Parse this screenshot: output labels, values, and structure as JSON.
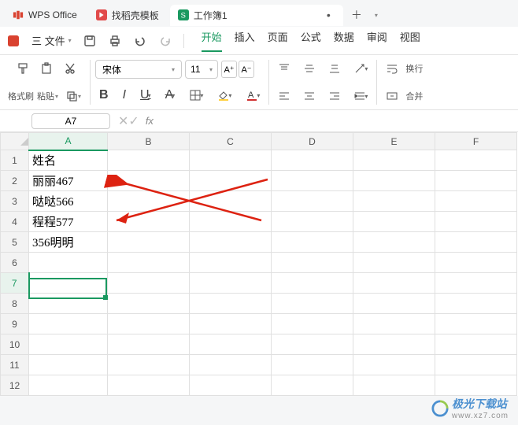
{
  "tabs": {
    "t0": "WPS Office",
    "t1": "找稻壳模板",
    "t2": "工作簿1"
  },
  "menubar": {
    "file": "三 文件",
    "menus": {
      "m0": "开始",
      "m1": "插入",
      "m2": "页面",
      "m3": "公式",
      "m4": "数据",
      "m5": "审阅",
      "m6": "视图"
    }
  },
  "toolbar": {
    "format_brush": "格式刷",
    "paste": "粘贴",
    "font_name": "宋体",
    "font_size": "11",
    "size_up": "A⁺",
    "size_down": "A⁻",
    "wrap": "换行",
    "merge": "合并"
  },
  "namebox": {
    "ref": "A7",
    "fx": "fx"
  },
  "grid": {
    "cols": {
      "A": "A",
      "B": "B",
      "C": "C",
      "D": "D",
      "E": "E",
      "F": "F"
    },
    "rows": {
      "r1": "1",
      "r2": "2",
      "r3": "3",
      "r4": "4",
      "r5": "5",
      "r6": "6",
      "r7": "7",
      "r8": "8",
      "r9": "9",
      "r10": "10",
      "r11": "11",
      "r12": "12"
    },
    "cells": {
      "A1": "姓名",
      "A2": "丽丽467",
      "A3": "哒哒566",
      "A4": "程程577",
      "A5": "356明明"
    }
  },
  "watermark": {
    "line1": "极光下载站",
    "line2": "www.xz7.com"
  }
}
